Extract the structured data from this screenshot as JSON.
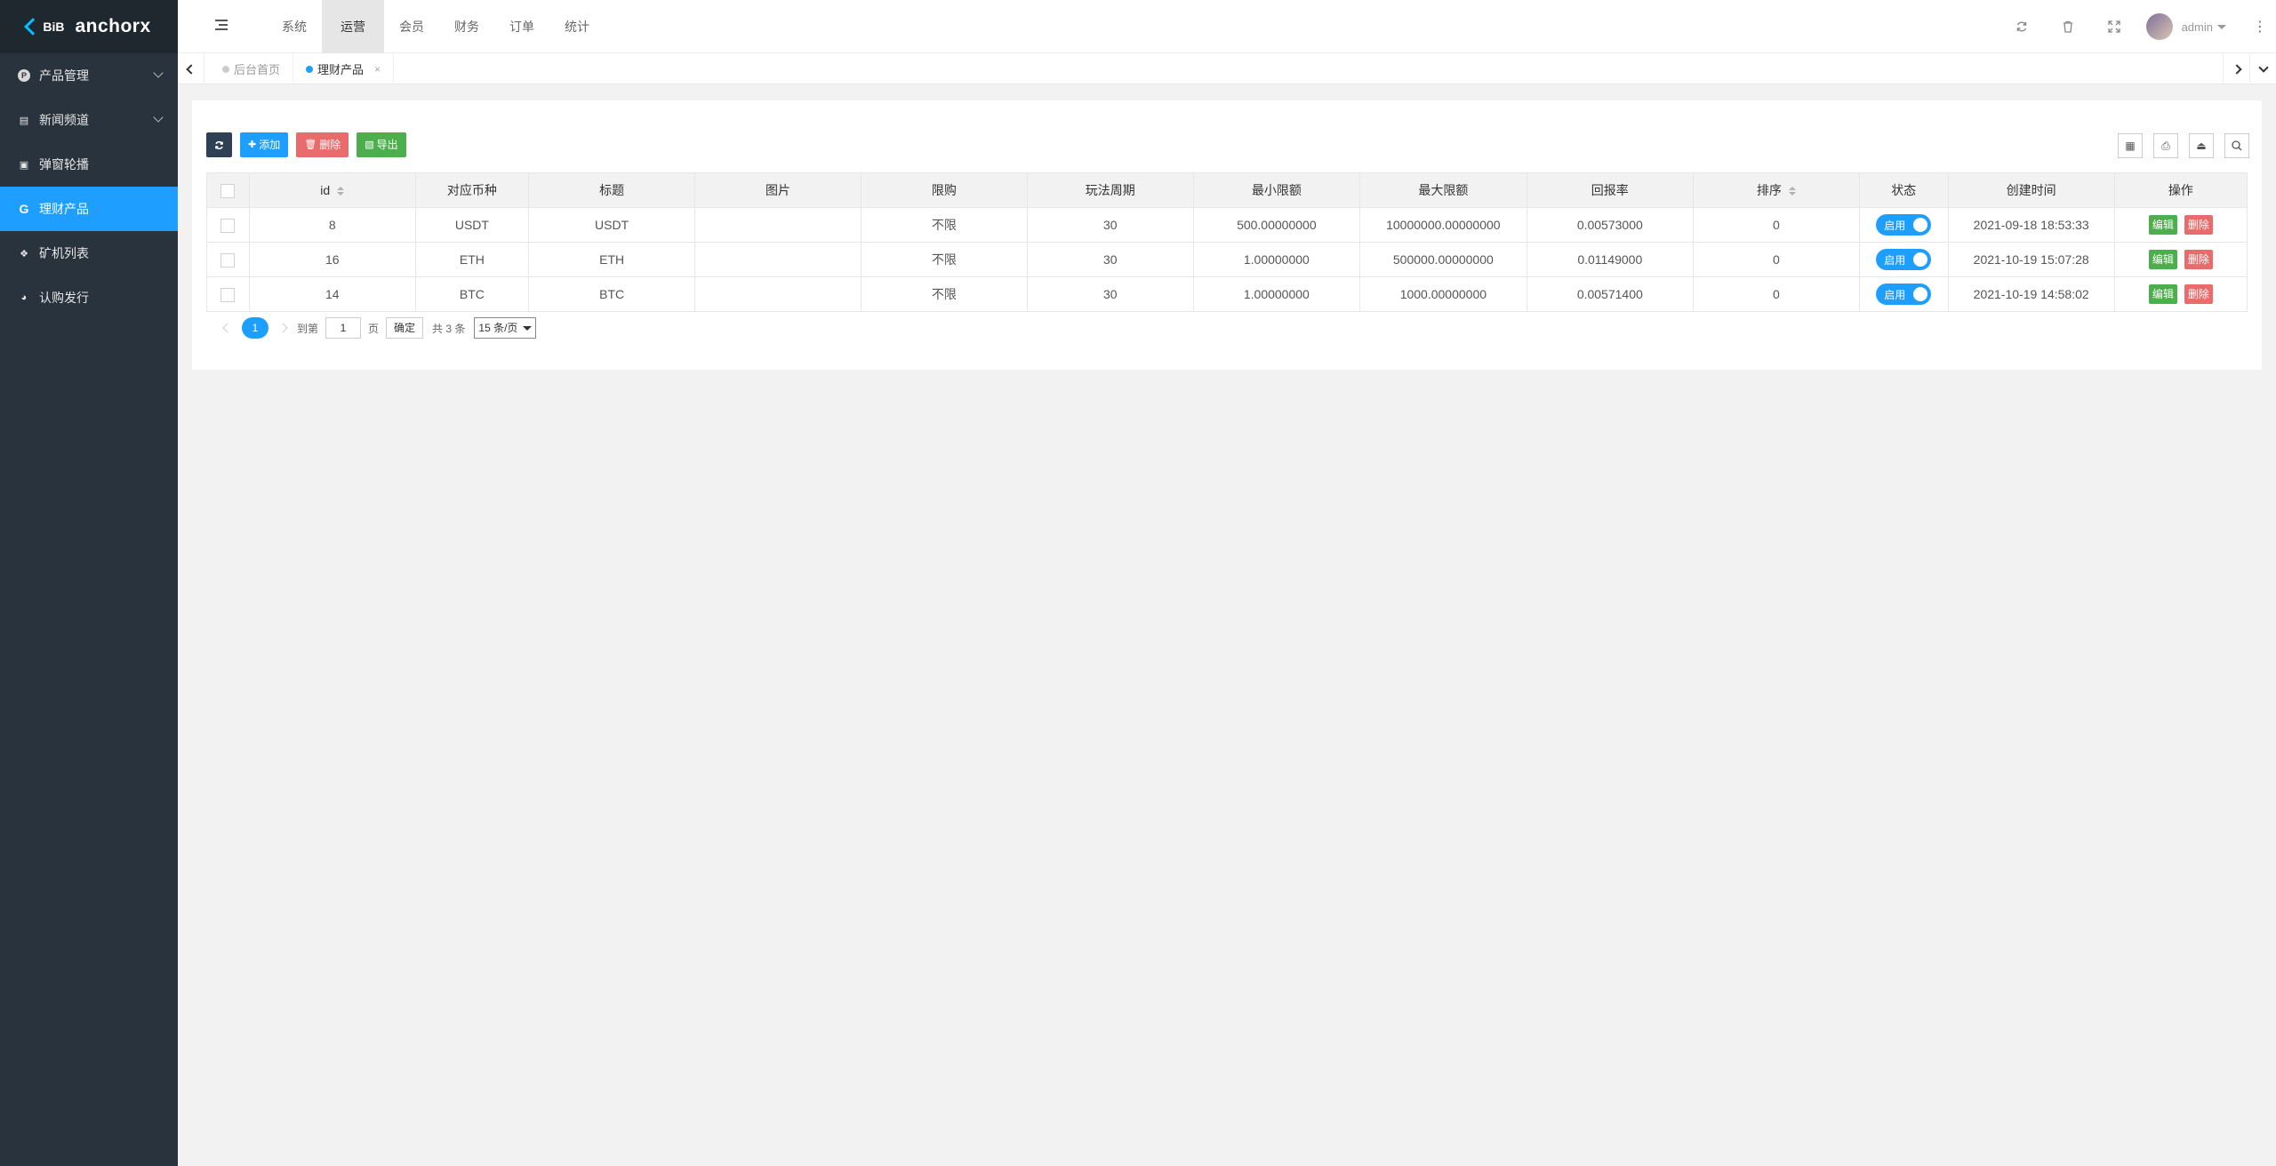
{
  "logo": {
    "mark": "BiB",
    "name": "anchorx"
  },
  "sidebar": {
    "items": [
      {
        "label": "产品管理",
        "icon": "P",
        "has_children": true
      },
      {
        "label": "新闻频道",
        "icon": "news-icon",
        "has_children": true
      },
      {
        "label": "弹窗轮播",
        "icon": "image-icon",
        "has_children": false
      },
      {
        "label": "理财产品",
        "icon": "G",
        "has_children": false,
        "active": true
      },
      {
        "label": "矿机列表",
        "icon": "cubes-icon",
        "has_children": false
      },
      {
        "label": "认购发行",
        "icon": "pie-chart-icon",
        "has_children": false
      }
    ]
  },
  "header": {
    "tabs": [
      {
        "label": "系统"
      },
      {
        "label": "运营",
        "active": true
      },
      {
        "label": "会员"
      },
      {
        "label": "财务"
      },
      {
        "label": "订单"
      },
      {
        "label": "统计"
      }
    ],
    "user": "admin"
  },
  "tabstrip": {
    "tabs": [
      {
        "label": "后台首页",
        "active": false
      },
      {
        "label": "理财产品",
        "active": true,
        "close": "×"
      }
    ]
  },
  "toolbar": {
    "refresh": "",
    "add": "添加",
    "delete": "删除",
    "export": "导出"
  },
  "table": {
    "columns": [
      "id",
      "对应币种",
      "标题",
      "图片",
      "限购",
      "玩法周期",
      "最小限额",
      "最大限额",
      "回报率",
      "排序",
      "状态",
      "创建时间",
      "操作"
    ],
    "rows": [
      {
        "id": "8",
        "coin": "USDT",
        "title": "USDT",
        "image": "",
        "limit": "不限",
        "cycle": "30",
        "min": "500.00000000",
        "max": "10000000.00000000",
        "rate": "0.00573000",
        "sort": "0",
        "status": "启用",
        "created": "2021-09-18 18:53:33"
      },
      {
        "id": "16",
        "coin": "ETH",
        "title": "ETH",
        "image": "",
        "limit": "不限",
        "cycle": "30",
        "min": "1.00000000",
        "max": "500000.00000000",
        "rate": "0.01149000",
        "sort": "0",
        "status": "启用",
        "created": "2021-10-19 15:07:28"
      },
      {
        "id": "14",
        "coin": "BTC",
        "title": "BTC",
        "image": "",
        "limit": "不限",
        "cycle": "30",
        "min": "1.00000000",
        "max": "1000.00000000",
        "rate": "0.00571400",
        "sort": "0",
        "status": "启用",
        "created": "2021-10-19 14:58:02"
      }
    ],
    "op_edit": "编辑",
    "op_delete": "删除"
  },
  "pager": {
    "current": "1",
    "goto_label": "到第",
    "goto_value": "1",
    "page_label": "页",
    "ok": "确定",
    "total": "共 3 条",
    "page_size": "15 条/页"
  },
  "colors": {
    "accent": "#1e9fff",
    "sidebar": "#28333e",
    "success": "#4cae4c",
    "danger": "#ea6b6b"
  }
}
